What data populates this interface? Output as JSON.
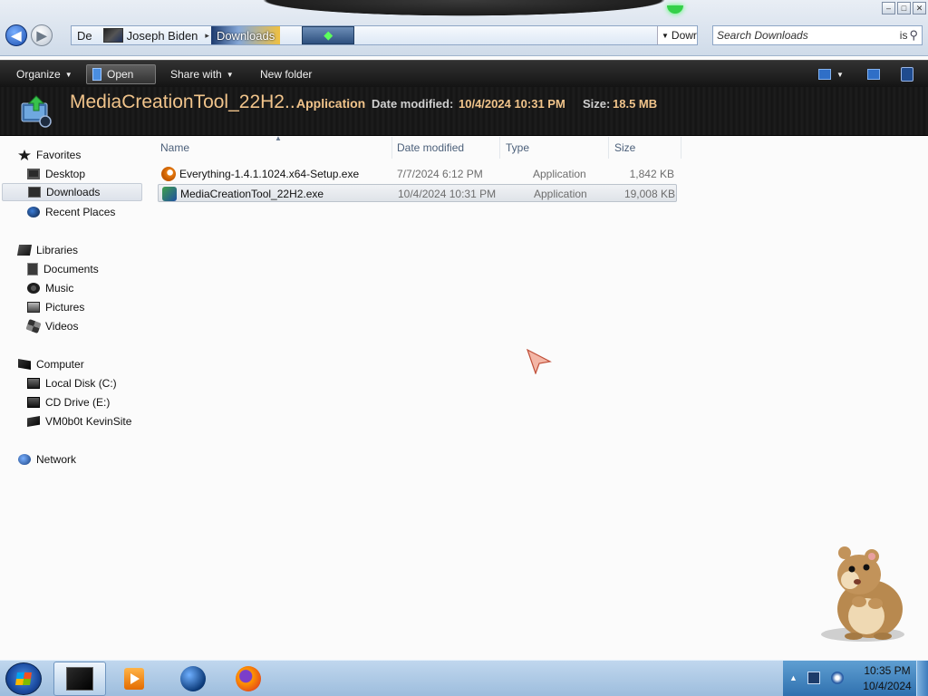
{
  "window": {
    "buttons": {
      "minimize": "–",
      "maximize": "□",
      "close": "✕"
    }
  },
  "address": {
    "back_glyph": "◀",
    "forward_glyph": "▶",
    "crumbs": [
      "Joseph Biden",
      "Downloads"
    ],
    "prefix_text": "De",
    "dropdown_text": "Dowr"
  },
  "search": {
    "placeholder": "Search Downloads",
    "suffix": "is",
    "icon": "search-icon"
  },
  "toolbar": {
    "organize": "Organize",
    "open": "Open",
    "share_with": "Share with",
    "new_folder": "New folder"
  },
  "details_pane": {
    "name": "MediaCreationTool_22H2...",
    "type": "Application",
    "modified_label": "Date modified:",
    "modified_value": "10/4/2024 10:31 PM",
    "size_label": "Size:",
    "size_value": "18.5 MB"
  },
  "nav": {
    "favorites": "Favorites",
    "desktop": "Desktop",
    "downloads": "Downloads",
    "recent_places": "Recent Places",
    "libraries": "Libraries",
    "documents": "Documents",
    "music": "Music",
    "pictures": "Pictures",
    "videos": "Videos",
    "computer": "Computer",
    "local_disk": "Local Disk (C:)",
    "cd_drive": "CD Drive (E:)",
    "network_drive": "VM0b0t KevinSite",
    "network": "Network"
  },
  "columns": {
    "name": "Name",
    "date_modified": "Date modified",
    "type": "Type",
    "size": "Size"
  },
  "files": [
    {
      "name": "Everything-1.4.1.1024.x64-Setup.exe",
      "date": "7/7/2024 6:12 PM",
      "type": "Application",
      "size": "1,842 KB",
      "selected": false
    },
    {
      "name": "MediaCreationTool_22H2.exe",
      "date": "10/4/2024 10:31 PM",
      "type": "Application",
      "size": "19,008 KB",
      "selected": true
    }
  ],
  "taskbar": {
    "time": "10:35 PM",
    "date": "10/4/2024",
    "tray_up": "▲"
  },
  "colors": {
    "details_text": "#f1c48b",
    "command_bar": "#1e1e1e",
    "taskbar": "#a9c6e3"
  }
}
